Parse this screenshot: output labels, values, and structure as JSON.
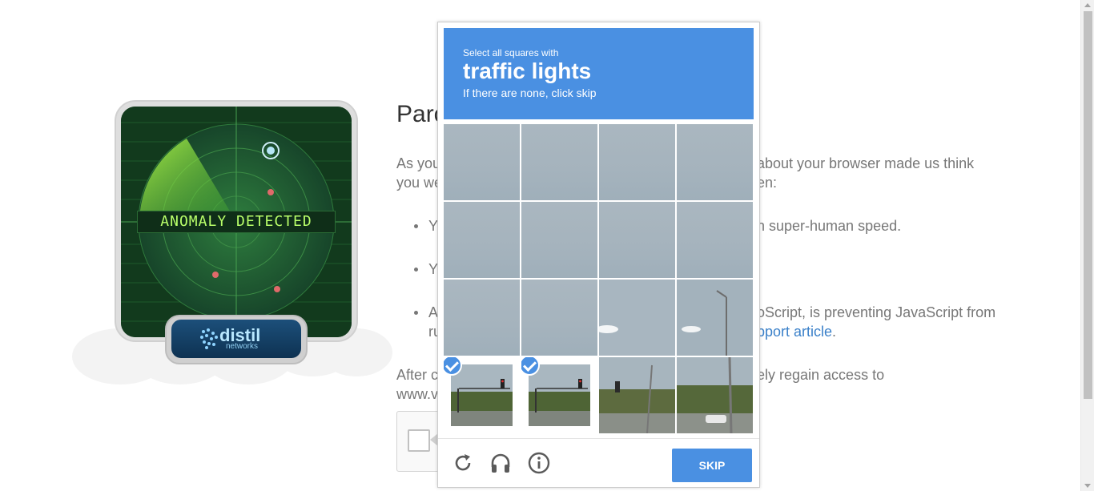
{
  "radar": {
    "banner_text": "ANOMALY DETECTED",
    "logo_name": "distil",
    "logo_sub": "networks"
  },
  "page": {
    "title_visible": "Parc",
    "para1_line1_left": "As you",
    "para1_line1_right": "about your browser made us think",
    "para1_line2_left": "you we",
    "para1_line2_right": "en:",
    "bullet1_left": "Y",
    "bullet1_right": "h super-human speed.",
    "bullet2_left": "Y",
    "bullet3_left": "A",
    "bullet3_right": "oScript, is preventing JavaScript from",
    "bullet3_line2_left": "ru",
    "bullet3_link": "pport article",
    "bullet3_end": ".",
    "para2_line1_left": "After c",
    "para2_line1_right": "ely regain access to",
    "para2_line2_left": "www.v"
  },
  "challenge": {
    "instruction": "Select all squares with",
    "target": "traffic lights",
    "hint": "If there are none, click skip",
    "tiles": [
      {
        "selected": false
      },
      {
        "selected": false
      },
      {
        "selected": false
      },
      {
        "selected": false
      },
      {
        "selected": false
      },
      {
        "selected": false
      },
      {
        "selected": false
      },
      {
        "selected": false
      },
      {
        "selected": false
      },
      {
        "selected": false
      },
      {
        "selected": false
      },
      {
        "selected": false
      },
      {
        "selected": true
      },
      {
        "selected": true
      },
      {
        "selected": false
      },
      {
        "selected": false
      }
    ],
    "footer": {
      "reload_icon": "reload-icon",
      "audio_icon": "headphones-icon",
      "info_icon": "info-icon",
      "skip_label": "SKIP"
    }
  },
  "colors": {
    "accent": "#4a90e2",
    "radar_green": "#143d1f",
    "text_gray": "#777777",
    "link": "#3a80c9"
  }
}
